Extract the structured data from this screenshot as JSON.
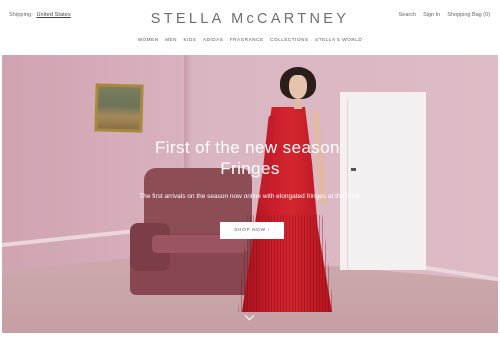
{
  "header": {
    "shipping_label": "Shipping:",
    "shipping_country": "United States",
    "logo": "STELLA McCARTNEY",
    "utility_links": [
      "Search",
      "Sign In",
      "Shopping Bag (0)"
    ]
  },
  "nav": {
    "items": [
      "WOMEN",
      "MEN",
      "KIDS",
      "ADIDAS",
      "FRAGRANCE",
      "COLLECTIONS",
      "STELLA'S WORLD"
    ]
  },
  "hero": {
    "title_line1": "First of the new season:",
    "title_line2": "Fringes",
    "subtitle": "The first arrivals on the season now online with elongated fringes at the front.",
    "cta_label": "SHOP NOW ›"
  },
  "icons": {
    "scroll": "chevron-down-icon"
  },
  "colors": {
    "wall": "#d9b5c1",
    "dress": "#c91f2b",
    "sofa": "#8d4d55",
    "text": "#333333"
  }
}
